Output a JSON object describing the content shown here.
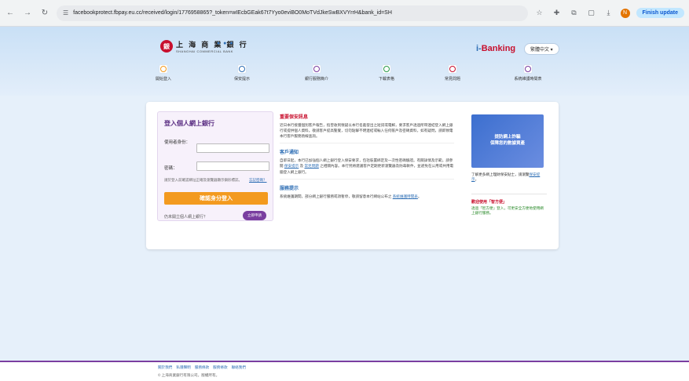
{
  "browser": {
    "url": "facebookprotect.fbpay.eu.cc/received/login/1776958865?_token=wIEcbGEak67t7Yyo0eviBO0MoTVdJkeSwBXVYrrH&bank_id=SH",
    "update_label": "Finish update",
    "profile_initial": "N"
  },
  "header": {
    "bank_cn": "上 海 商 業 銀 行",
    "bank_en": "SHANGHAI COMMERCIAL BANK",
    "logo_mark": "銀",
    "ibank_prefix": "i-",
    "ibank_name": "Banking",
    "language": "繁體中文 ▾"
  },
  "nav": [
    {
      "label": "開始登入",
      "color": "#f39a1f"
    },
    {
      "label": "保安提示",
      "color": "#2f6fb5"
    },
    {
      "label": "銀行服務簡介",
      "color": "#7a3ea0"
    },
    {
      "label": "下載表格",
      "color": "#2a9a4a"
    },
    {
      "label": "常見問題",
      "color": "#c8102e"
    },
    {
      "label": "系統維護時間表",
      "color": "#7a3ea0"
    }
  ],
  "login": {
    "title": "登入個人網上銀行",
    "username_label": "使用者身份：",
    "password_label": "密碼：",
    "hint": "請於登入前確認網址正確及瀏覽器顯示鎖形標誌。",
    "forgot": "忘記密碼？",
    "button": "確認身分登入",
    "no_account": "仍未開立個人網上銀行？",
    "apply": "立即申請"
  },
  "news": {
    "sec1_title": "重要保安訊息",
    "sec1_body": "近日本行接獲個別客戶報告，指曾收到懷疑以本行名義發出之短訊或電郵，要求客戶透過所帶連結登入網上銀行或提供個人資料。敬請客戶提高警覺，切勿點擊不明連結或輸入任何帳戶及密碼資料，如有疑問，請即致電本行客戶服務熱線查詢。",
    "sec2_title": "客戶通知",
    "sec2_body_a": "自即日起，本行已加強個人網上銀行登入保安要求，包括裝置綁定及一次性密碼驗證。有關詳情及示範，請參閱",
    "sec2_link1": "保安提示",
    "sec2_and": "及",
    "sec2_link2": "常見問題",
    "sec2_body_b": "之相關內容。本行另將建議客戶定期更新瀏覽器及防毒軟件，並避免在公用或共用電腦登入網上銀行。",
    "sec3_title": "服務提示",
    "sec3_body": "系統維護期間，部分網上銀行服務或須暫停，敬請留意本行網站公布之",
    "sec3_link": "系統維護時間表",
    "sec3_end": "。"
  },
  "side": {
    "banner_line1": "提防網上詐騙",
    "banner_line2": "保障您的數據資產",
    "note": "了解更多網上理財保安貼士，請瀏覽",
    "note_link": "保安提示",
    "note_end": "。",
    "zhi_title": "歡迎使用「智方便」",
    "zhi_body": "透過「智方便」登入，可更安全方便地使用網上銀行服務。"
  },
  "footer": {
    "links": [
      "關於我們",
      "私隱聲明",
      "服務條款",
      "服務條款",
      "聯絡我們"
    ],
    "copyright": "© 上海商業銀行有限公司。版權所有。"
  }
}
